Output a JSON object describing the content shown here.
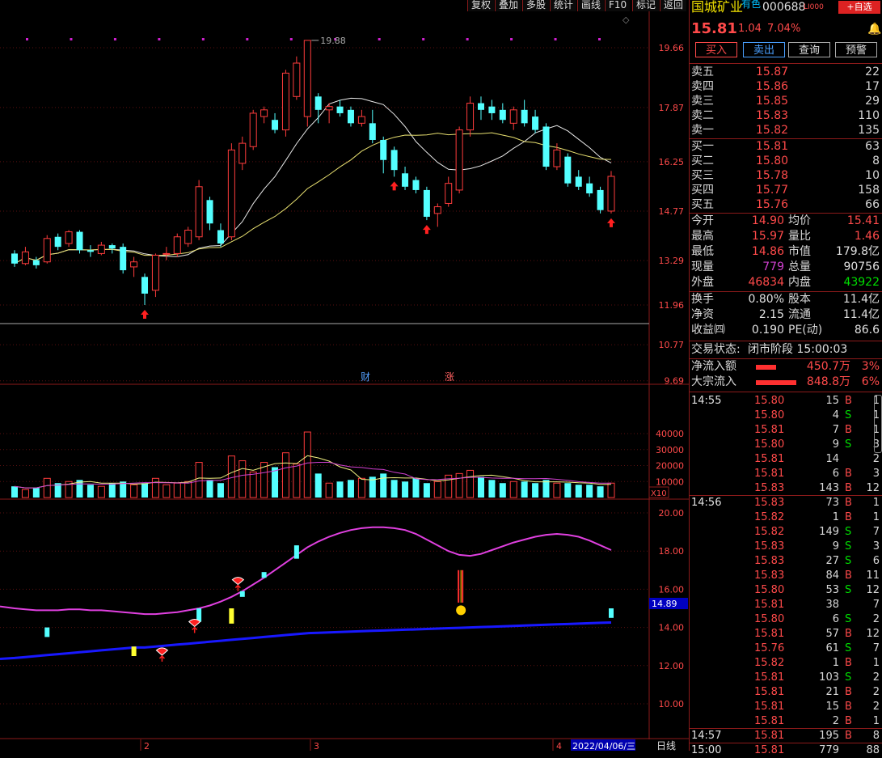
{
  "toolbar": {
    "items": [
      "复权",
      "叠加",
      "多股",
      "统计",
      "画线",
      "F10",
      "标记",
      "返回"
    ]
  },
  "stock": {
    "name": "国城矿业",
    "tag": "有色",
    "code": "000688",
    "level": "LI000",
    "add_watch": "+自选",
    "price": "15.81",
    "change": "1.04",
    "pct": "7.04%"
  },
  "actions": [
    "买入",
    "卖出",
    "查询",
    "预警"
  ],
  "asks": [
    {
      "label": "卖五",
      "price": "15.87",
      "vol": "22"
    },
    {
      "label": "卖四",
      "price": "15.86",
      "vol": "17"
    },
    {
      "label": "卖三",
      "price": "15.85",
      "vol": "29"
    },
    {
      "label": "卖二",
      "price": "15.83",
      "vol": "110"
    },
    {
      "label": "卖一",
      "price": "15.82",
      "vol": "135"
    }
  ],
  "bids": [
    {
      "label": "买一",
      "price": "15.81",
      "vol": "63"
    },
    {
      "label": "买二",
      "price": "15.80",
      "vol": "8"
    },
    {
      "label": "买三",
      "price": "15.78",
      "vol": "10"
    },
    {
      "label": "买四",
      "price": "15.77",
      "vol": "158"
    },
    {
      "label": "买五",
      "price": "15.76",
      "vol": "66"
    }
  ],
  "quote": [
    {
      "l1": "今开",
      "v1": "14.90",
      "c1": "r",
      "l2": "均价",
      "v2": "15.41",
      "c2": "r"
    },
    {
      "l1": "最高",
      "v1": "15.97",
      "c1": "r",
      "l2": "量比",
      "v2": "1.46",
      "c2": "r"
    },
    {
      "l1": "最低",
      "v1": "14.86",
      "c1": "r",
      "l2": "市值",
      "v2": "179.8亿",
      "c2": "w"
    },
    {
      "l1": "现量",
      "v1": "779",
      "c1": "m",
      "l2": "总量",
      "v2": "90756",
      "c2": "w"
    },
    {
      "l1": "外盘",
      "v1": "46834",
      "c1": "r",
      "l2": "内盘",
      "v2": "43922",
      "c2": "g"
    }
  ],
  "fund": [
    {
      "l1": "换手",
      "v1": "0.80%",
      "l2": "股本",
      "v2": "11.4亿"
    },
    {
      "l1": "净资",
      "v1": "2.15",
      "l2": "流通",
      "v2": "11.4亿"
    },
    {
      "l1": "收益㈣",
      "v1": "0.190",
      "l2": "PE(动)",
      "v2": "86.6"
    }
  ],
  "status": {
    "label": "交易状态:",
    "value": "闭市阶段 15:00:03"
  },
  "flows": [
    {
      "label": "净流入额",
      "amount": "450.7万",
      "pct": "3%",
      "bar": 0.5
    },
    {
      "label": "大宗流入",
      "amount": "848.8万",
      "pct": "6%",
      "bar": 1.0
    }
  ],
  "ticks": [
    {
      "time": "14:55",
      "price": "15.80",
      "vol": "15",
      "side": "B",
      "n": "1"
    },
    {
      "time": "",
      "price": "15.80",
      "vol": "4",
      "side": "S",
      "n": "1"
    },
    {
      "time": "",
      "price": "15.81",
      "vol": "7",
      "side": "B",
      "n": "1"
    },
    {
      "time": "",
      "price": "15.80",
      "vol": "9",
      "side": "S",
      "n": "3"
    },
    {
      "time": "",
      "price": "15.81",
      "vol": "14",
      "side": "",
      "n": "2"
    },
    {
      "time": "",
      "price": "15.81",
      "vol": "6",
      "side": "B",
      "n": "3"
    },
    {
      "time": "",
      "price": "15.83",
      "vol": "143",
      "side": "B",
      "n": "12"
    },
    {
      "time": "14:56",
      "price": "15.83",
      "vol": "73",
      "side": "B",
      "n": "1"
    },
    {
      "time": "",
      "price": "15.82",
      "vol": "1",
      "side": "B",
      "n": "1"
    },
    {
      "time": "",
      "price": "15.82",
      "vol": "149",
      "side": "S",
      "n": "7"
    },
    {
      "time": "",
      "price": "15.83",
      "vol": "9",
      "side": "S",
      "n": "3"
    },
    {
      "time": "",
      "price": "15.83",
      "vol": "27",
      "side": "S",
      "n": "6"
    },
    {
      "time": "",
      "price": "15.83",
      "vol": "84",
      "side": "B",
      "n": "11"
    },
    {
      "time": "",
      "price": "15.80",
      "vol": "53",
      "side": "S",
      "n": "12"
    },
    {
      "time": "",
      "price": "15.81",
      "vol": "38",
      "side": "",
      "n": "7"
    },
    {
      "time": "",
      "price": "15.80",
      "vol": "6",
      "side": "S",
      "n": "2"
    },
    {
      "time": "",
      "price": "15.81",
      "vol": "57",
      "side": "B",
      "n": "12"
    },
    {
      "time": "",
      "price": "15.76",
      "vol": "61",
      "side": "S",
      "n": "7"
    },
    {
      "time": "",
      "price": "15.82",
      "vol": "1",
      "side": "B",
      "n": "1"
    },
    {
      "time": "",
      "price": "15.81",
      "vol": "103",
      "side": "S",
      "n": "2"
    },
    {
      "time": "",
      "price": "15.81",
      "vol": "21",
      "side": "B",
      "n": "2"
    },
    {
      "time": "",
      "price": "15.81",
      "vol": "15",
      "side": "B",
      "n": "2"
    },
    {
      "time": "",
      "price": "15.81",
      "vol": "2",
      "side": "B",
      "n": "1"
    },
    {
      "time": "14:57",
      "price": "15.81",
      "vol": "195",
      "side": "B",
      "n": "8"
    },
    {
      "time": "15:00",
      "price": "15.81",
      "vol": "779",
      "side": "",
      "n": "88"
    }
  ],
  "chart_data": {
    "type": "candlestick",
    "price_axis": [
      "19.66",
      "17.87",
      "16.25",
      "14.77",
      "13.29",
      "11.96",
      "10.77",
      "9.69"
    ],
    "price_high_label": "19.88",
    "volume_axis": [
      "40000",
      "30000",
      "20000",
      "10000"
    ],
    "volume_unit": "X10",
    "indicator_axis": [
      "20.00",
      "18.00",
      "16.00",
      "14.00",
      "12.00",
      "10.00"
    ],
    "indicator_current": "14.89",
    "x_labels": [
      "2",
      "3",
      "4"
    ],
    "date_label": "2022/04/06/三",
    "period": "日线",
    "event_labels": [
      "财",
      "涨"
    ],
    "candles": [
      {
        "o": 13.5,
        "c": 13.2,
        "h": 13.6,
        "l": 13.1
      },
      {
        "o": 13.2,
        "c": 13.55,
        "h": 13.7,
        "l": 13.15
      },
      {
        "o": 13.3,
        "c": 13.15,
        "h": 13.4,
        "l": 13.05
      },
      {
        "o": 13.25,
        "c": 13.95,
        "h": 14.05,
        "l": 13.2
      },
      {
        "o": 14.0,
        "c": 13.7,
        "h": 14.1,
        "l": 13.6
      },
      {
        "o": 13.8,
        "c": 14.15,
        "h": 14.2,
        "l": 13.7
      },
      {
        "o": 14.15,
        "c": 13.6,
        "h": 14.2,
        "l": 13.5
      },
      {
        "o": 13.6,
        "c": 13.55,
        "h": 13.75,
        "l": 13.4
      },
      {
        "o": 13.5,
        "c": 13.75,
        "h": 13.85,
        "l": 13.45
      },
      {
        "o": 13.75,
        "c": 13.65,
        "h": 13.8,
        "l": 13.5
      },
      {
        "o": 13.7,
        "c": 13.0,
        "h": 13.8,
        "l": 12.9
      },
      {
        "o": 13.1,
        "c": 13.25,
        "h": 13.4,
        "l": 12.8
      },
      {
        "o": 12.8,
        "c": 12.3,
        "h": 12.9,
        "l": 11.96
      },
      {
        "o": 12.4,
        "c": 13.45,
        "h": 13.5,
        "l": 12.2
      },
      {
        "o": 13.5,
        "c": 13.5,
        "h": 13.7,
        "l": 13.3
      },
      {
        "o": 13.5,
        "c": 14.0,
        "h": 14.1,
        "l": 13.4
      },
      {
        "o": 13.8,
        "c": 14.2,
        "h": 14.3,
        "l": 13.7
      },
      {
        "o": 14.0,
        "c": 15.5,
        "h": 15.7,
        "l": 13.9
      },
      {
        "o": 15.1,
        "c": 14.4,
        "h": 15.2,
        "l": 14.2
      },
      {
        "o": 14.2,
        "c": 13.8,
        "h": 14.4,
        "l": 13.7
      },
      {
        "o": 14.0,
        "c": 16.6,
        "h": 16.8,
        "l": 13.9
      },
      {
        "o": 16.2,
        "c": 16.8,
        "h": 17.0,
        "l": 16.0
      },
      {
        "o": 16.7,
        "c": 17.7,
        "h": 17.8,
        "l": 16.6
      },
      {
        "o": 17.6,
        "c": 17.8,
        "h": 17.9,
        "l": 17.4
      },
      {
        "o": 17.5,
        "c": 17.2,
        "h": 17.7,
        "l": 17.1
      },
      {
        "o": 17.2,
        "c": 18.9,
        "h": 19.0,
        "l": 17.0
      },
      {
        "o": 18.2,
        "c": 19.2,
        "h": 19.4,
        "l": 18.1
      },
      {
        "o": 17.6,
        "c": 19.88,
        "h": 19.88,
        "l": 17.3
      },
      {
        "o": 18.2,
        "c": 17.8,
        "h": 18.3,
        "l": 17.4
      },
      {
        "o": 17.8,
        "c": 17.9,
        "h": 18.0,
        "l": 17.4
      },
      {
        "o": 17.9,
        "c": 17.7,
        "h": 18.1,
        "l": 17.6
      },
      {
        "o": 17.8,
        "c": 17.4,
        "h": 17.9,
        "l": 17.3
      },
      {
        "o": 17.4,
        "c": 17.6,
        "h": 17.8,
        "l": 17.3
      },
      {
        "o": 17.4,
        "c": 16.9,
        "h": 17.8,
        "l": 16.8
      },
      {
        "o": 16.9,
        "c": 16.3,
        "h": 17.0,
        "l": 15.9
      },
      {
        "o": 16.6,
        "c": 16.0,
        "h": 16.7,
        "l": 15.8
      },
      {
        "o": 15.9,
        "c": 15.5,
        "h": 16.1,
        "l": 15.4
      },
      {
        "o": 15.7,
        "c": 15.4,
        "h": 15.8,
        "l": 15.3
      },
      {
        "o": 15.4,
        "c": 14.6,
        "h": 15.5,
        "l": 14.5
      },
      {
        "o": 14.7,
        "c": 14.9,
        "h": 15.0,
        "l": 14.3
      },
      {
        "o": 15.0,
        "c": 15.6,
        "h": 15.8,
        "l": 14.9
      },
      {
        "o": 15.4,
        "c": 17.2,
        "h": 17.3,
        "l": 15.3
      },
      {
        "o": 17.2,
        "c": 18.0,
        "h": 18.2,
        "l": 17.0
      },
      {
        "o": 18.0,
        "c": 17.8,
        "h": 18.2,
        "l": 17.5
      },
      {
        "o": 17.9,
        "c": 17.7,
        "h": 18.1,
        "l": 17.5
      },
      {
        "o": 17.8,
        "c": 17.5,
        "h": 18.0,
        "l": 17.4
      },
      {
        "o": 17.4,
        "c": 17.8,
        "h": 17.9,
        "l": 17.2
      },
      {
        "o": 17.8,
        "c": 17.4,
        "h": 18.1,
        "l": 17.3
      },
      {
        "o": 17.6,
        "c": 17.2,
        "h": 17.8,
        "l": 17.1
      },
      {
        "o": 17.3,
        "c": 16.1,
        "h": 17.4,
        "l": 16.0
      },
      {
        "o": 16.1,
        "c": 16.6,
        "h": 16.8,
        "l": 16.0
      },
      {
        "o": 16.4,
        "c": 15.6,
        "h": 16.5,
        "l": 15.5
      },
      {
        "o": 15.8,
        "c": 15.5,
        "h": 16.0,
        "l": 15.4
      },
      {
        "o": 15.6,
        "c": 15.3,
        "h": 15.8,
        "l": 15.2
      },
      {
        "o": 15.4,
        "c": 14.8,
        "h": 15.5,
        "l": 14.7
      },
      {
        "o": 14.77,
        "c": 15.81,
        "h": 15.97,
        "l": 14.7
      }
    ],
    "volumes": [
      7000,
      5000,
      6000,
      12000,
      9000,
      10000,
      11000,
      8000,
      7000,
      9000,
      10000,
      8000,
      9000,
      12000,
      8000,
      9000,
      10000,
      22000,
      11000,
      9000,
      26000,
      23000,
      16000,
      22000,
      19000,
      28000,
      21000,
      41000,
      15000,
      9000,
      10000,
      11000,
      12000,
      13000,
      15000,
      11000,
      10000,
      12000,
      9000,
      10000,
      14000,
      15000,
      17000,
      13000,
      11000,
      9000,
      10000,
      10000,
      9000,
      11000,
      9000,
      9000,
      8000,
      8000,
      7000,
      9000
    ],
    "indicator_upper": [
      15.0,
      14.95,
      14.9,
      14.9,
      14.9,
      14.95,
      14.95,
      14.9,
      14.9,
      14.85,
      14.8,
      14.75,
      14.7,
      14.7,
      14.75,
      14.8,
      14.9,
      15.0,
      15.15,
      15.35,
      15.6,
      15.9,
      16.25,
      16.6,
      17.0,
      17.4,
      17.8,
      18.2,
      18.5,
      18.75,
      18.95,
      19.1,
      19.2,
      19.25,
      19.25,
      19.2,
      19.1,
      18.9,
      18.6,
      18.3,
      18.0,
      17.8,
      17.75,
      17.85,
      18.05,
      18.25,
      18.45,
      18.6,
      18.75,
      18.85,
      18.9,
      18.85,
      18.75,
      18.55,
      18.3,
      18.05
    ],
    "indicator_lower": [
      12.4,
      12.45,
      12.5,
      12.55,
      12.6,
      12.65,
      12.7,
      12.75,
      12.8,
      12.85,
      12.9,
      12.95,
      12.95,
      13.0,
      13.05,
      13.1,
      13.15,
      13.2,
      13.25,
      13.3,
      13.35,
      13.4,
      13.45,
      13.5,
      13.55,
      13.6,
      13.65,
      13.7,
      13.72,
      13.74,
      13.76,
      13.78,
      13.8,
      13.82,
      13.84,
      13.86,
      13.88,
      13.9,
      13.92,
      13.94,
      13.96,
      13.98,
      14.0,
      14.02,
      14.04,
      14.06,
      14.08,
      14.1,
      14.12,
      14.14,
      14.16,
      14.18,
      14.2,
      14.22,
      14.24,
      14.26
    ]
  }
}
